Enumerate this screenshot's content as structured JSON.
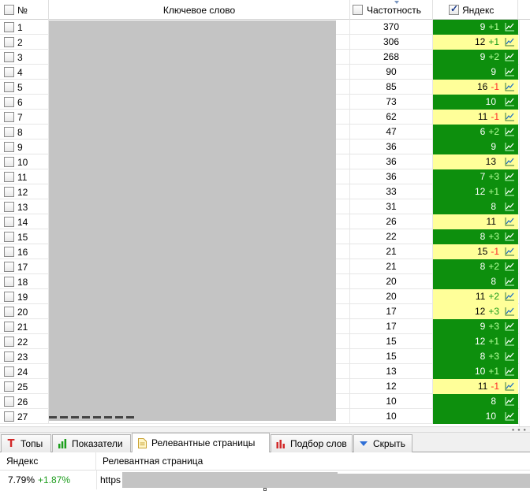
{
  "table": {
    "headers": {
      "num": "№",
      "keyword": "Ключевое слово",
      "frequency": "Частотность",
      "yandex": "Яндекс"
    },
    "header_checks": {
      "num": false,
      "frequency": false,
      "yandex": true
    },
    "rows": [
      {
        "num": "1",
        "freq": "370",
        "pos": "9",
        "delta": "+1",
        "color": "green"
      },
      {
        "num": "2",
        "freq": "306",
        "pos": "12",
        "delta": "+1",
        "color": "yellow"
      },
      {
        "num": "3",
        "freq": "268",
        "pos": "9",
        "delta": "+2",
        "color": "green"
      },
      {
        "num": "4",
        "freq": "90",
        "pos": "9",
        "delta": "",
        "color": "green"
      },
      {
        "num": "5",
        "freq": "85",
        "pos": "16",
        "delta": "-1",
        "color": "yellow"
      },
      {
        "num": "6",
        "freq": "73",
        "pos": "10",
        "delta": "",
        "color": "green"
      },
      {
        "num": "7",
        "freq": "62",
        "pos": "11",
        "delta": "-1",
        "color": "yellow"
      },
      {
        "num": "8",
        "freq": "47",
        "pos": "6",
        "delta": "+2",
        "color": "green"
      },
      {
        "num": "9",
        "freq": "36",
        "pos": "9",
        "delta": "",
        "color": "green"
      },
      {
        "num": "10",
        "freq": "36",
        "pos": "13",
        "delta": "",
        "color": "yellow"
      },
      {
        "num": "11",
        "freq": "36",
        "pos": "7",
        "delta": "+3",
        "color": "green"
      },
      {
        "num": "12",
        "freq": "33",
        "pos": "12",
        "delta": "+1",
        "color": "green"
      },
      {
        "num": "13",
        "freq": "31",
        "pos": "8",
        "delta": "",
        "color": "green"
      },
      {
        "num": "14",
        "freq": "26",
        "pos": "11",
        "delta": "",
        "color": "yellow"
      },
      {
        "num": "15",
        "freq": "22",
        "pos": "8",
        "delta": "+3",
        "color": "green"
      },
      {
        "num": "16",
        "freq": "21",
        "pos": "15",
        "delta": "-1",
        "color": "yellow"
      },
      {
        "num": "17",
        "freq": "21",
        "pos": "8",
        "delta": "+2",
        "color": "green"
      },
      {
        "num": "18",
        "freq": "20",
        "pos": "8",
        "delta": "",
        "color": "green"
      },
      {
        "num": "19",
        "freq": "20",
        "pos": "11",
        "delta": "+2",
        "color": "yellow"
      },
      {
        "num": "20",
        "freq": "17",
        "pos": "12",
        "delta": "+3",
        "color": "yellow"
      },
      {
        "num": "21",
        "freq": "17",
        "pos": "9",
        "delta": "+3",
        "color": "green"
      },
      {
        "num": "22",
        "freq": "15",
        "pos": "12",
        "delta": "+1",
        "color": "green"
      },
      {
        "num": "23",
        "freq": "15",
        "pos": "8",
        "delta": "+3",
        "color": "green"
      },
      {
        "num": "24",
        "freq": "13",
        "pos": "10",
        "delta": "+1",
        "color": "green"
      },
      {
        "num": "25",
        "freq": "12",
        "pos": "11",
        "delta": "-1",
        "color": "yellow"
      },
      {
        "num": "26",
        "freq": "10",
        "pos": "8",
        "delta": "",
        "color": "green"
      },
      {
        "num": "27",
        "freq": "10",
        "pos": "10",
        "delta": "",
        "color": "green"
      }
    ],
    "colors": {
      "green": "#0d8f0d",
      "yellow": "#ffff99",
      "negative": "#ff2a2a"
    }
  },
  "tabs": [
    {
      "label": "Топы",
      "icon": "tops-t-icon",
      "active": false
    },
    {
      "label": "Показатели",
      "icon": "bar-chart-icon",
      "active": false
    },
    {
      "label": "Релевантные страницы",
      "icon": "page-icon",
      "active": true
    },
    {
      "label": "Подбор слов",
      "icon": "column-chart-icon",
      "active": false
    },
    {
      "label": "Скрыть",
      "icon": "arrow-down-icon",
      "active": false
    }
  ],
  "panel": {
    "col_engine": "Яндекс",
    "col_page": "Релевантная страница",
    "row": {
      "value": "7.79%",
      "delta": "+1.87%",
      "url": "https"
    }
  }
}
